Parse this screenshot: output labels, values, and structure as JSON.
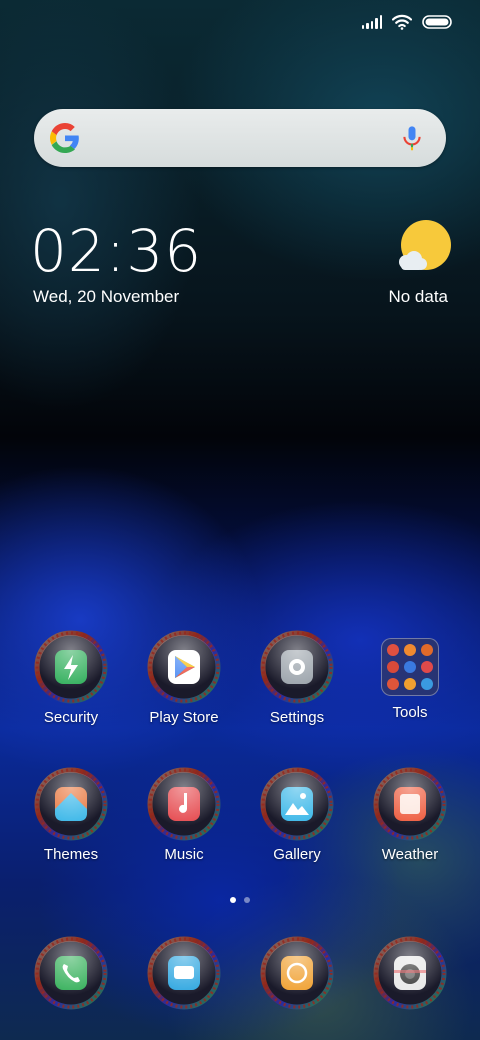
{
  "status_bar": {
    "signal_icon": "signal-bars-icon",
    "wifi_icon": "wifi-icon",
    "battery_icon": "battery-icon"
  },
  "search": {
    "left_icon": "google-g-icon",
    "right_icon": "microphone-icon"
  },
  "clock": {
    "time": "02:36",
    "date": "Wed, 20 November"
  },
  "weather": {
    "icon": "partly-sunny-icon",
    "text": "No data"
  },
  "apps_row1": [
    {
      "label": "Security",
      "icon": "security-icon",
      "color": "#2fae5a"
    },
    {
      "label": "Play Store",
      "icon": "play-store-icon",
      "color": "#ffffff"
    },
    {
      "label": "Settings",
      "icon": "settings-icon",
      "color": "#9aa2aa"
    },
    {
      "label": "Tools",
      "icon": "tools-folder-icon",
      "color": "#3c3c50"
    }
  ],
  "apps_row2": [
    {
      "label": "Themes",
      "icon": "themes-icon",
      "color": "#e8743a"
    },
    {
      "label": "Music",
      "icon": "music-icon",
      "color": "#e5484d"
    },
    {
      "label": "Gallery",
      "icon": "gallery-icon",
      "color": "#38b6e8"
    },
    {
      "label": "Weather",
      "icon": "weather-icon",
      "color": "#ee5a3c"
    }
  ],
  "dock": [
    {
      "icon": "phone-icon",
      "color": "#35b05a"
    },
    {
      "icon": "messages-icon",
      "color": "#2ea6e0"
    },
    {
      "icon": "browser-icon",
      "color": "#f0a030"
    },
    {
      "icon": "camera-icon",
      "color": "#444444"
    }
  ],
  "page_indicator": {
    "current": 1,
    "total": 2
  }
}
